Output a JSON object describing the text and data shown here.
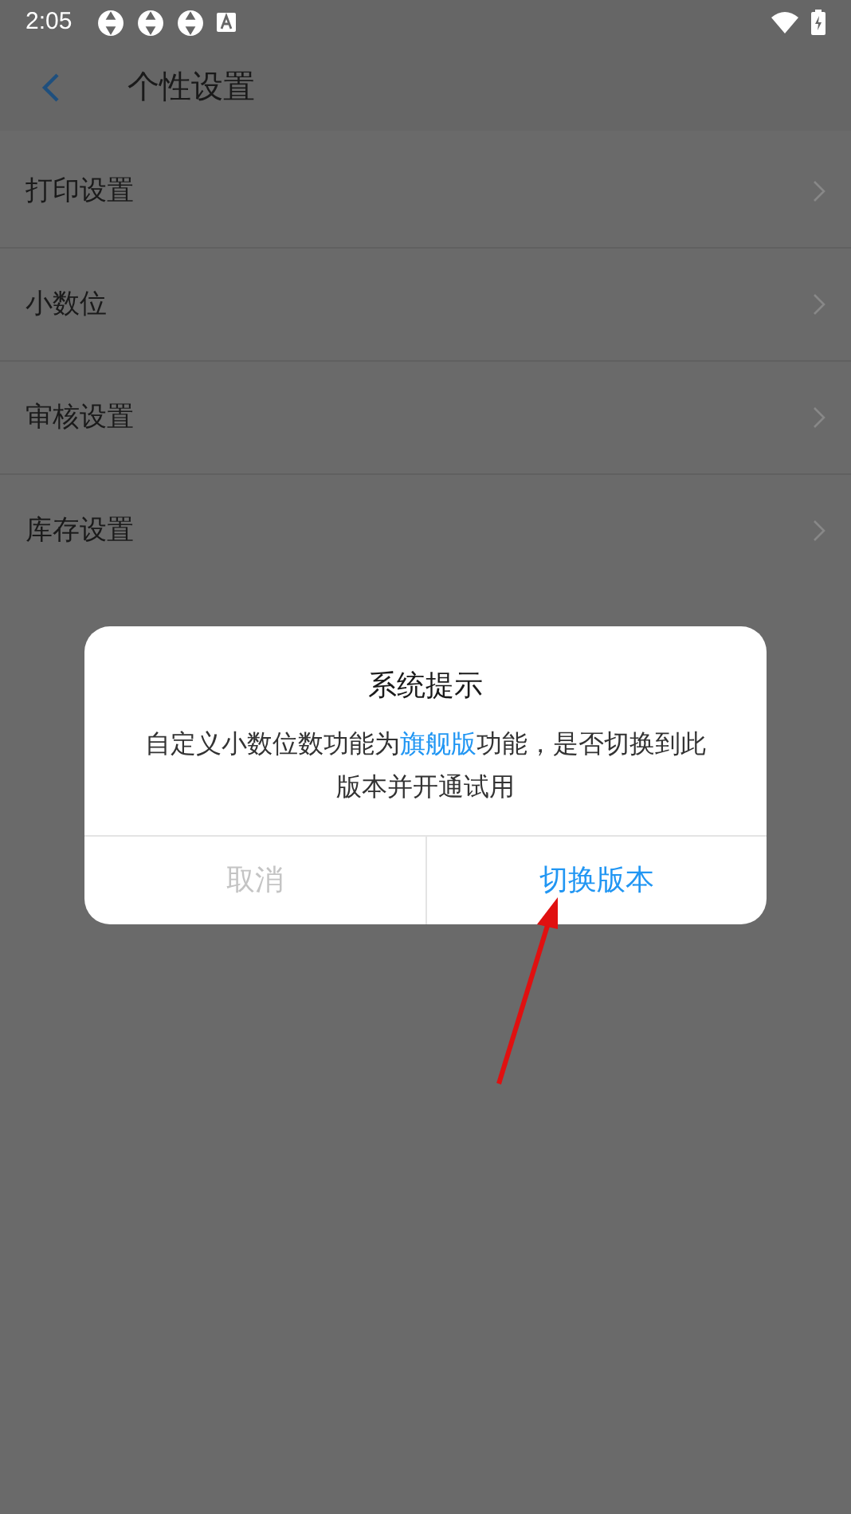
{
  "status_bar": {
    "time": "2:05"
  },
  "header": {
    "title": "个性设置"
  },
  "settings": [
    {
      "label": "打印设置"
    },
    {
      "label": "小数位"
    },
    {
      "label": "审核设置"
    },
    {
      "label": "库存设置"
    }
  ],
  "dialog": {
    "title": "系统提示",
    "message": [
      {
        "text": "自定义小数位数功能为",
        "highlight": false
      },
      {
        "text": "旗舰版",
        "highlight": true
      },
      {
        "text": "功能，是否切换到此版本并开通试用",
        "highlight": false
      }
    ],
    "buttons": [
      {
        "label": "取消",
        "kind": "cancel"
      },
      {
        "label": "切换版本",
        "kind": "confirm"
      }
    ]
  }
}
